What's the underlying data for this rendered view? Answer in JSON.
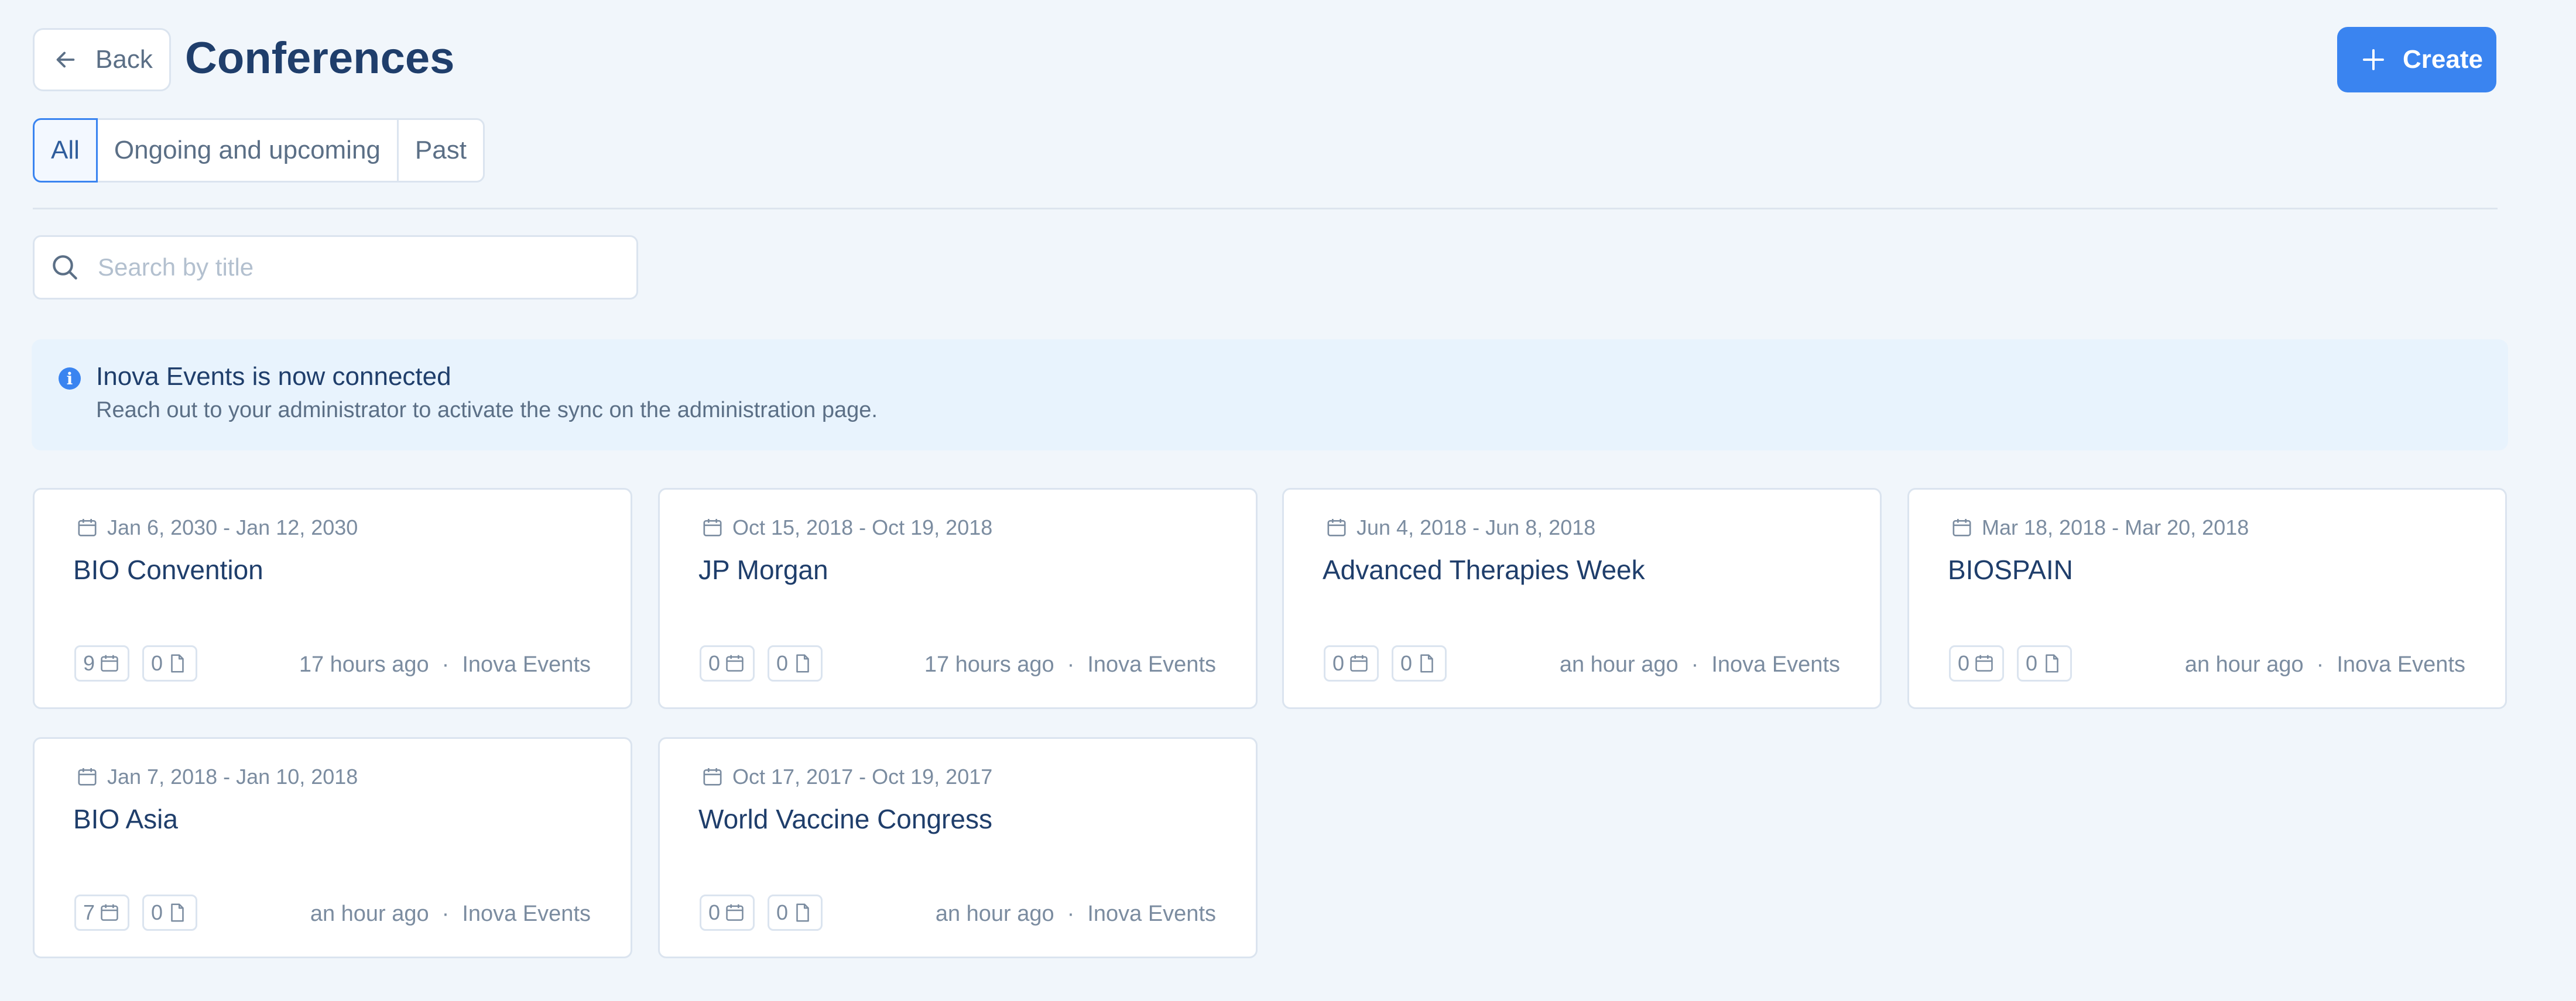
{
  "header": {
    "back_label": "Back",
    "title": "Conferences",
    "create_label": "Create"
  },
  "tabs": [
    {
      "label": "All",
      "active": true
    },
    {
      "label": "Ongoing and upcoming",
      "active": false
    },
    {
      "label": "Past",
      "active": false
    }
  ],
  "search": {
    "placeholder": "Search by title",
    "value": ""
  },
  "banner": {
    "title": "Inova Events is now connected",
    "subtitle": "Reach out to your administrator to activate the sync on the administration page."
  },
  "conferences": [
    {
      "date": "Jan 6, 2030 - Jan 12, 2030",
      "title": "BIO Convention",
      "sessions": "9",
      "documents": "0",
      "updated": "17 hours ago",
      "source": "Inova Events"
    },
    {
      "date": "Oct 15, 2018 - Oct 19, 2018",
      "title": "JP Morgan",
      "sessions": "0",
      "documents": "0",
      "updated": "17 hours ago",
      "source": "Inova Events"
    },
    {
      "date": "Jun 4, 2018 - Jun 8, 2018",
      "title": "Advanced Therapies Week",
      "sessions": "0",
      "documents": "0",
      "updated": "an hour ago",
      "source": "Inova Events"
    },
    {
      "date": "Mar 18, 2018 - Mar 20, 2018",
      "title": "BIOSPAIN",
      "sessions": "0",
      "documents": "0",
      "updated": "an hour ago",
      "source": "Inova Events"
    },
    {
      "date": "Jan 7, 2018 - Jan 10, 2018",
      "title": "BIO Asia",
      "sessions": "7",
      "documents": "0",
      "updated": "an hour ago",
      "source": "Inova Events"
    },
    {
      "date": "Oct 17, 2017 - Oct 19, 2017",
      "title": "World Vaccine Congress",
      "sessions": "0",
      "documents": "0",
      "updated": "an hour ago",
      "source": "Inova Events"
    }
  ],
  "separator": "·",
  "colors": {
    "accent": "#3a84f0",
    "title": "#1f3e6b",
    "muted": "#7b8ca0",
    "background": "#f1f6fb"
  }
}
